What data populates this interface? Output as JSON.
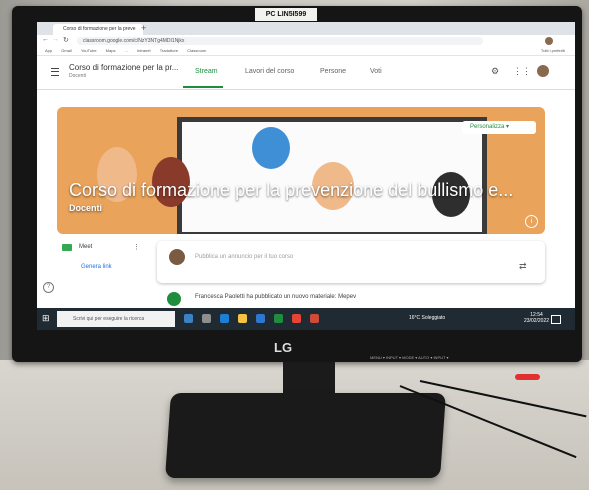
{
  "monitor": {
    "sticker": "PC LIN5I599",
    "brand": "LG",
    "buttons_text": "MENU ▾ INPUT ▾ MODE ▾ AUTO ▾ INPUT ▾"
  },
  "browser": {
    "tab_title": "Corso di formazione per la preve",
    "address": "classroom.google.com/c/NzY3NTg4MDI1Njkx",
    "bookmarks": [
      "App",
      "Gmail",
      "YouTube",
      "Maps",
      "...",
      "Intranet",
      "Traduttore",
      "Classroom",
      "Tutti i preferiti"
    ]
  },
  "classroom": {
    "class_title": "Corso di formazione per la pr...",
    "class_subtitle": "Docenti",
    "tabs": [
      "Stream",
      "Lavori del corso",
      "Persone",
      "Voti"
    ],
    "banner_title": "Corso di formazione per la prevenzione del bullismo e...",
    "banner_subtitle": "Docenti",
    "customize_label": "Personalizza",
    "meet_label": "Meet",
    "meet_link": "Genera link",
    "post_placeholder": "Pubblica un annuncio per il tuo corso",
    "material_text": "Francesca Paoletti ha pubblicato un nuovo materiale: Mepev"
  },
  "taskbar": {
    "search_placeholder": "Scrivi qui per eseguire la ricerca",
    "weather": "16°C Soleggiato",
    "time": "12:54",
    "date": "23/02/2022"
  },
  "colors": {
    "accent": "#1e8e3e",
    "banner": "#e9a35a",
    "taskbar": "#1f2a33"
  }
}
